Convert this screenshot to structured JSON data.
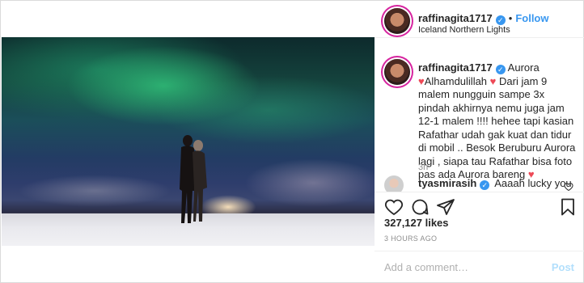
{
  "header": {
    "username": "raffinagita1717",
    "separator": "•",
    "follow_label": "Follow",
    "location": "Iceland Northern Lights"
  },
  "post": {
    "image_alt": "Couple under aurora borealis on a snowy field",
    "caption_username": "raffinagita1717",
    "caption_lead": "Aurora",
    "caption_heart_1": "♥",
    "caption_word_2": "Alhamdulillah",
    "caption_heart_2": "♥",
    "caption_text": "Dari jam 9 malem nungguin sampe 3x pindah akhirnya nemu juga jam 12-1 malem !!!! hehee tapi kasian Rafathar udah gak kuat dan tidur di mobil .. Besok Beruburu Aurora lagi , siapa tau Rafathar bisa foto pas ada Aurora bareng",
    "caption_heart_3": "♥",
    "time_ago": "3h"
  },
  "comment": {
    "username": "tyasmirasih",
    "text": "Aaaah lucky you"
  },
  "stats": {
    "likes": "327,127 likes",
    "posted": "3 HOURS AGO"
  },
  "add_comment": {
    "placeholder": "Add a comment…",
    "post_label": "Post"
  },
  "icons": {
    "like": "heart-icon",
    "comment": "comment-icon",
    "share": "share-icon",
    "save": "bookmark-icon",
    "verified": "verified-badge-icon"
  },
  "colors": {
    "link_blue": "#3897f0",
    "heart_red": "#ed4956",
    "post_disabled": "#b2dffc"
  }
}
